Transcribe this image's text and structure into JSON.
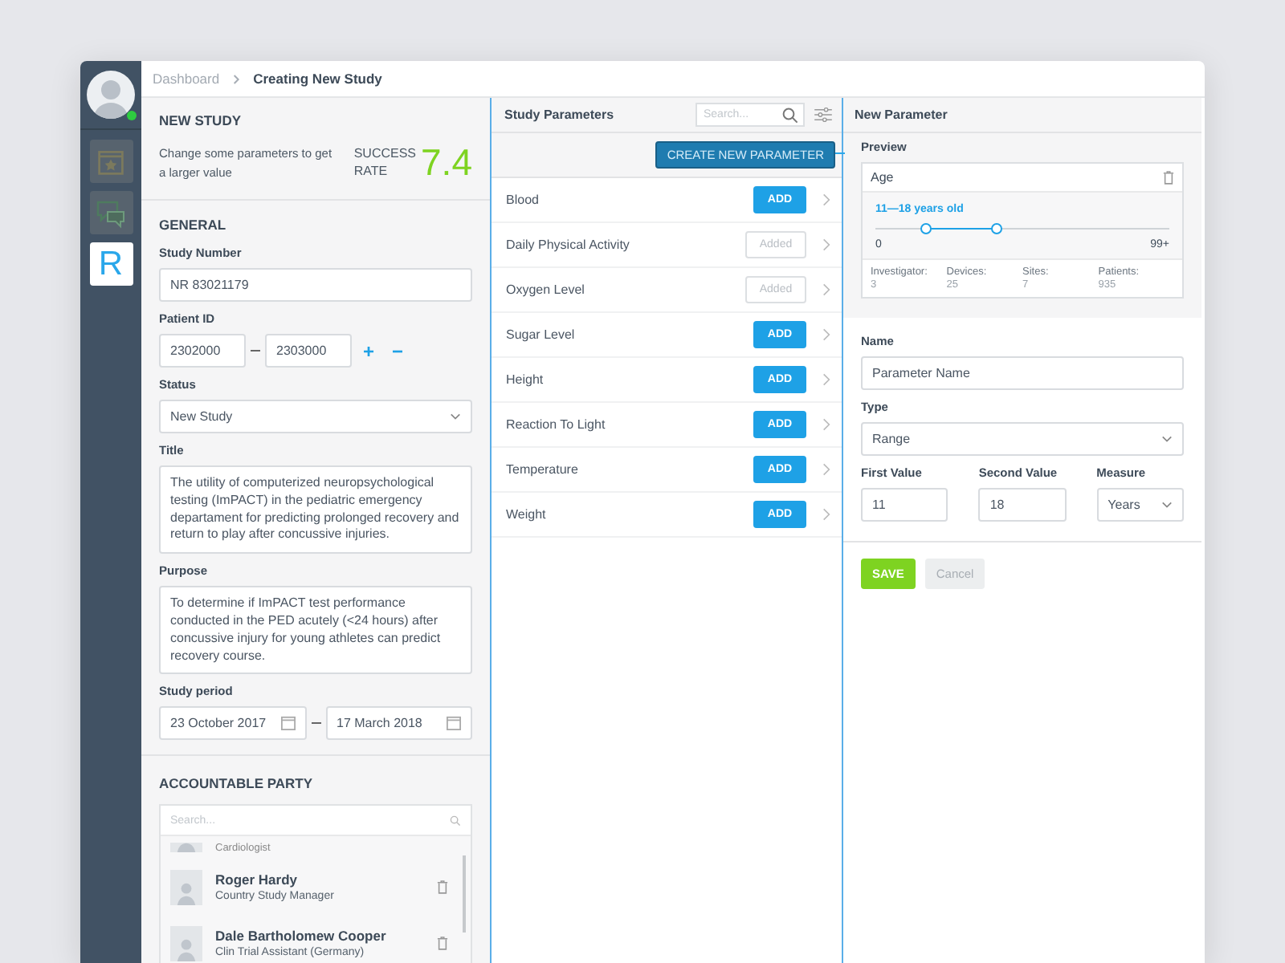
{
  "user": {
    "online": true
  },
  "rail": {
    "items": [
      {
        "kind": "calendar",
        "selected": false
      },
      {
        "kind": "chat",
        "selected": false
      },
      {
        "kind": "letter",
        "text": "R",
        "selected": true
      }
    ]
  },
  "breadcrumb": [
    "Dashboard",
    "Creating New Study"
  ],
  "new_study": {
    "title": "NEW STUDY",
    "hint": "Change some parameters to get a larger value",
    "rate_label": "SUCCESS RATE",
    "rate": "7.4"
  },
  "general": {
    "title": "GENERAL",
    "study_number": {
      "label": "Study Number",
      "value": "NR 83021179"
    },
    "patient_id": {
      "label": "Patient ID",
      "from": "2302000",
      "to": "2303000",
      "add": "+",
      "remove": "−"
    },
    "status": {
      "label": "Status",
      "value": "New Study"
    },
    "title_field": {
      "label": "Title",
      "value": "The utility of computerized neuropsychological testing (ImPACT) in the pediatric emergency departament for predicting prolonged recovery and return to play after concussive injuries."
    },
    "purpose": {
      "label": "Purpose",
      "value": "To determine if ImPACT test performance conducted in the PED acutely (<24 hours) after concussive injury for young athletes can predict recovery course."
    },
    "period": {
      "label": "Study period",
      "from": "23 October 2017",
      "to": "17 March 2018"
    }
  },
  "accountable_party": {
    "title": "ACCOUNTABLE PARTY",
    "search_placeholder": "Search...",
    "people": [
      {
        "role": "Cardiologist"
      },
      {
        "name": "Roger Hardy",
        "role": "Country Study Manager"
      },
      {
        "name": "Dale Bartholomew Cooper",
        "role": "Clin Trial Assistant (Germany)"
      }
    ]
  },
  "study_parameters": {
    "title": "Study Parameters",
    "search_placeholder": "Search...",
    "create_button": "CREATE NEW PARAMETER",
    "items": [
      {
        "name": "Blood",
        "added": false,
        "action": "ADD"
      },
      {
        "name": "Daily Physical Activity",
        "added": true,
        "action": "Added"
      },
      {
        "name": "Oxygen Level",
        "added": true,
        "action": "Added"
      },
      {
        "name": "Sugar Level",
        "added": false,
        "action": "ADD"
      },
      {
        "name": "Height",
        "added": false,
        "action": "ADD"
      },
      {
        "name": "Reaction To Light",
        "added": false,
        "action": "ADD"
      },
      {
        "name": "Temperature",
        "added": false,
        "action": "ADD"
      },
      {
        "name": "Weight",
        "added": false,
        "action": "ADD"
      }
    ]
  },
  "new_parameter": {
    "title": "New Parameter",
    "preview_label": "Preview",
    "preview": {
      "name": "Age",
      "range_label": "11—18 years old",
      "thumbs": [
        {
          "level": 0.17
        },
        {
          "level": 0.41
        }
      ],
      "min": "0",
      "max": "99+",
      "stats": [
        {
          "label": "Investigator:",
          "value": "3"
        },
        {
          "label": "Devices:",
          "value": "25"
        },
        {
          "label": "Sites:",
          "value": "7"
        },
        {
          "label": "Patients:",
          "value": "935"
        }
      ]
    },
    "name": {
      "label": "Name",
      "value": "Parameter Name"
    },
    "type": {
      "label": "Type",
      "value": "Range"
    },
    "first_value": {
      "label": "First Value",
      "value": "11"
    },
    "second_value": {
      "label": "Second Value",
      "value": "18"
    },
    "measure": {
      "label": "Measure",
      "value": "Years"
    },
    "buttons": [
      {
        "kind": "primary",
        "label": "SAVE"
      },
      {
        "kind": "secondary",
        "label": "Cancel"
      }
    ]
  }
}
